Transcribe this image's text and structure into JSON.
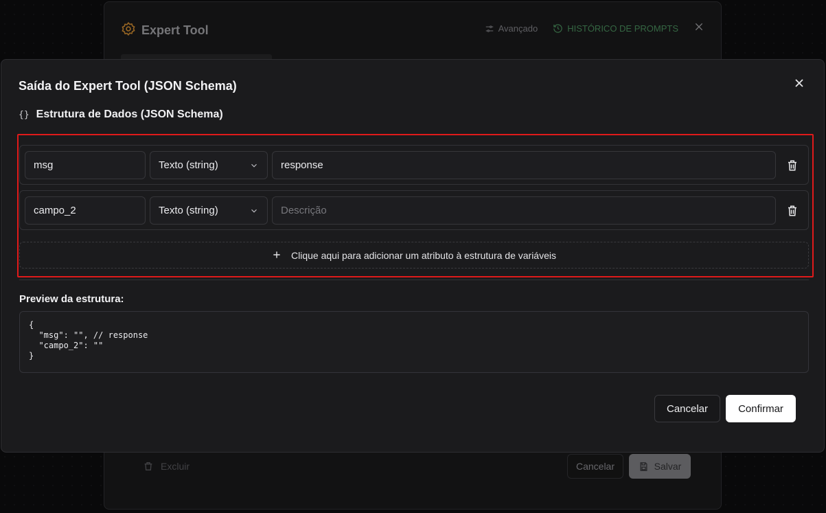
{
  "background_dialog": {
    "title": "Expert Tool",
    "advanced_label": "Avançado",
    "history_label": "HISTÓRICO DE PROMPTS",
    "delete_label": "Excluir",
    "cancel_label": "Cancelar",
    "save_label": "Salvar",
    "accent_color": "#3f7a4f"
  },
  "modal": {
    "title": "Saída do Expert Tool (JSON Schema)",
    "section_icon": "{}",
    "section_title": "Estrutura de Dados (JSON Schema)",
    "fields": [
      {
        "name": "msg",
        "type": "Texto (string)",
        "description": "response",
        "description_placeholder": "Descrição"
      },
      {
        "name": "campo_2",
        "type": "Texto (string)",
        "description": "",
        "description_placeholder": "Descrição"
      }
    ],
    "add_attribute_label": "Clique aqui para adicionar um atributo à estrutura de variáveis",
    "preview_label": "Preview da estrutura:",
    "preview_code": "{\n  \"msg\": \"\", // response\n  \"campo_2\": \"\"\n}",
    "cancel_label": "Cancelar",
    "confirm_label": "Confirmar",
    "highlight_color": "#e01a1a"
  }
}
